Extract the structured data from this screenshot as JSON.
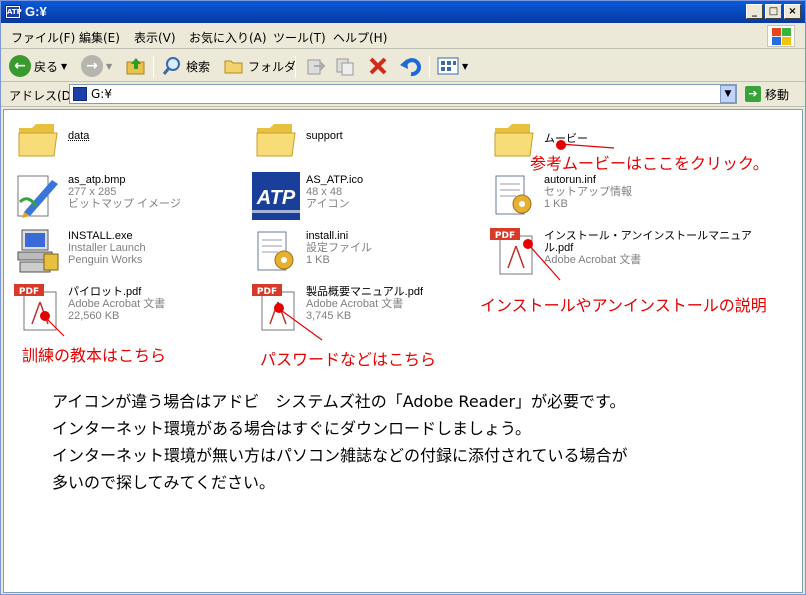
{
  "window": {
    "title": "G:¥",
    "app_icon_text": "ATP"
  },
  "caption_buttons": {
    "minimize": "_",
    "maximize": "□",
    "close": "×"
  },
  "menu": [
    "ファイル(F)",
    "編集(E)",
    "表示(V)",
    "お気に入り(A)",
    "ツール(T)",
    "ヘルプ(H)"
  ],
  "toolbar": {
    "back": "戻る",
    "search": "検索",
    "folders": "フォルダ"
  },
  "address": {
    "label": "アドレス(D)",
    "value": "G:¥",
    "go": "移動"
  },
  "files": [
    {
      "name": "data",
      "type": "",
      "detail": "",
      "icon": "folder-icon"
    },
    {
      "name": "support",
      "type": "",
      "detail": "",
      "icon": "folder-icon"
    },
    {
      "name": "ムービー",
      "type": "",
      "detail": "",
      "icon": "folder-icon"
    },
    {
      "name": "as_atp.bmp",
      "type": "277 x 285",
      "detail": "ビットマップ イメージ",
      "icon": "bitmap-paint-icon"
    },
    {
      "name": "AS_ATP.ico",
      "type": "48 x 48",
      "detail": "アイコン",
      "icon": "atp-logo-icon"
    },
    {
      "name": "autorun.inf",
      "type": "セットアップ情報",
      "detail": "1 KB",
      "icon": "setup-info-icon"
    },
    {
      "name": "INSTALL.exe",
      "type": "Installer Launch",
      "detail": "Penguin Works",
      "icon": "installer-computer-icon"
    },
    {
      "name": "install.ini",
      "type": "設定ファイル",
      "detail": "1 KB",
      "icon": "settings-file-icon"
    },
    {
      "name": "インストール・アンインストールマニュアル.pdf",
      "name_line1": "インストール・アンインストールマニュア",
      "name_line2": "ル.pdf",
      "type": "Adobe Acrobat 文書",
      "detail": "",
      "icon": "pdf-icon"
    },
    {
      "name": "パイロット.pdf",
      "type": "Adobe Acrobat 文書",
      "detail": "22,560 KB",
      "icon": "pdf-icon"
    },
    {
      "name": "製品概要マニュアル.pdf",
      "type": "Adobe Acrobat 文書",
      "detail": "3,745 KB",
      "icon": "pdf-icon"
    }
  ],
  "annotations": {
    "movie": "参考ムービーはここをクリック。",
    "install": "インストールやアンインストールの説明",
    "pilot": "訓練の教本はこちら",
    "overview": "パスワードなどはこちら"
  },
  "note_lines": [
    "アイコンが違う場合はアドビ　システムズ社の「Adobe Reader」が必要です。",
    "インターネット環境がある場合はすぐにダウンロードしましょう。",
    "インターネット環境が無い方はパソコン雑誌などの付録に添付されている場合が",
    "多いので探してみてください。"
  ],
  "colors": {
    "annotation": "#e60000",
    "title_bar": "#0a5ad8"
  }
}
